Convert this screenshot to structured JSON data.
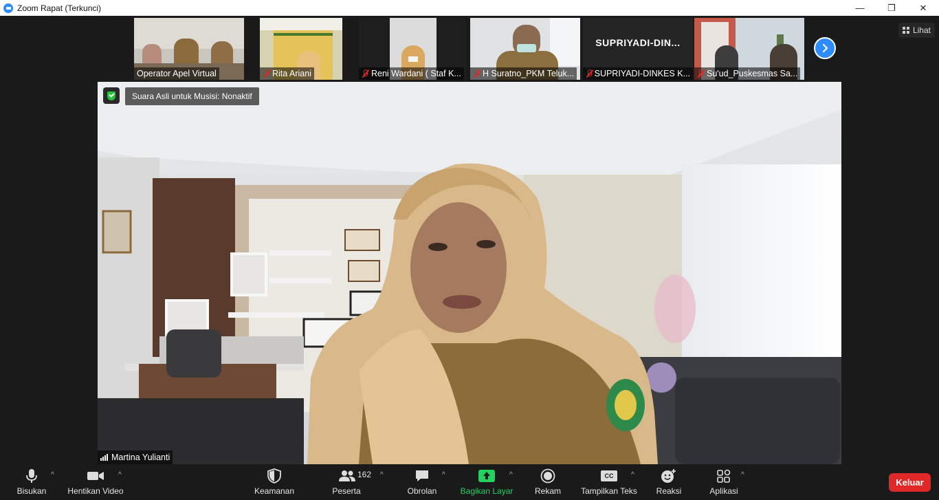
{
  "window": {
    "title": "Zoom Rapat (Terkunci)",
    "controls": [
      "—",
      "❐",
      "✕"
    ]
  },
  "gallery": {
    "participants": [
      {
        "name": "Operator Apel Virtual",
        "muted": false
      },
      {
        "name": "Rita Ariani",
        "muted": true
      },
      {
        "name": "Reni Wardani ( Staf K...",
        "muted": true
      },
      {
        "name": "H Suratno_PKM Teluk...",
        "muted": true
      },
      {
        "name": "SUPRIYADI-DINKES K...",
        "muted": true,
        "card_text": "SUPRIYADI-DIN..."
      },
      {
        "name": "Su'ud_Puskesmas Sa...",
        "muted": true
      }
    ],
    "next_icon": "chevron-right-icon",
    "view_label": "Lihat"
  },
  "main": {
    "audio_notice": "Suara Asli untuk Musisi: Nonaktif",
    "speaker_name": "Martina Yulianti"
  },
  "toolbar": {
    "mute_label": "Bisukan",
    "video_label": "Hentikan Video",
    "security_label": "Keamanan",
    "participants_label": "Peserta",
    "participants_count": "162",
    "chat_label": "Obrolan",
    "share_label": "Bagikan Layar",
    "record_label": "Rekam",
    "captions_label": "Tampilkan Teks",
    "captions_badge": "CC",
    "reactions_label": "Reaksi",
    "apps_label": "Aplikasi",
    "leave_label": "Keluar"
  },
  "colors": {
    "accent": "#2d8cff",
    "share_green": "#23d160",
    "leave_red": "#e02828",
    "muted_red": "#e02828",
    "secure_green": "#23c43a"
  }
}
